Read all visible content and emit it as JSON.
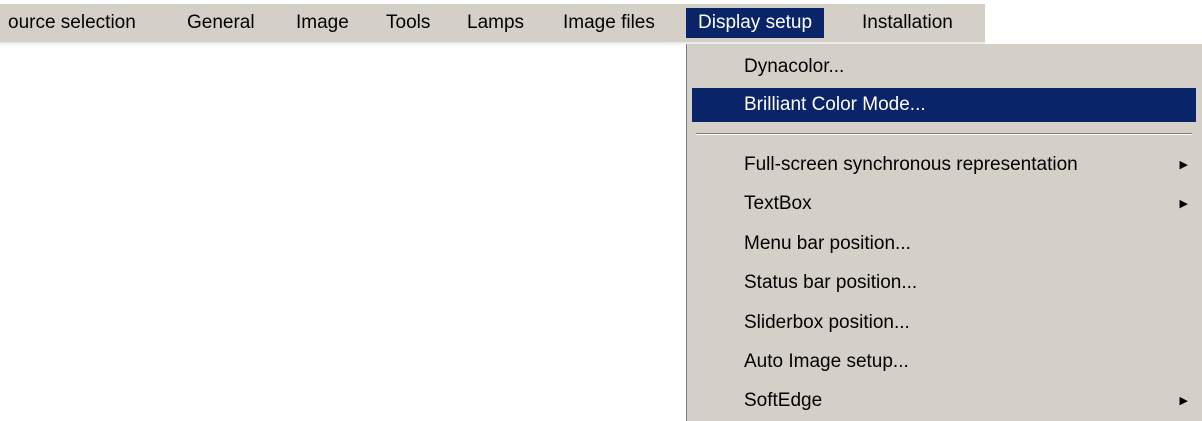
{
  "menubar": {
    "items": [
      {
        "label": "ource selection"
      },
      {
        "label": "General"
      },
      {
        "label": "Image"
      },
      {
        "label": "Tools"
      },
      {
        "label": "Lamps"
      },
      {
        "label": "Image files"
      },
      {
        "label": "Display setup",
        "active": true
      },
      {
        "label": "Installation"
      }
    ]
  },
  "dropdown": {
    "items": [
      {
        "label": "Dynacolor..."
      },
      {
        "label": "Brilliant Color Mode...",
        "highlighted": true
      },
      {
        "label": "Full-screen synchronous representation",
        "submenu_icon": "chevron-right-icon"
      },
      {
        "label": "TextBox",
        "submenu_icon": "chevron-right-icon"
      },
      {
        "label": "Menu bar position..."
      },
      {
        "label": "Status bar position..."
      },
      {
        "label": "Sliderbox position..."
      },
      {
        "label": "Auto Image setup..."
      },
      {
        "label": "SoftEdge",
        "submenu_icon": "chevron-right-icon"
      }
    ],
    "arrow_glyph": "▶"
  },
  "colors": {
    "menu_background": "#d4d0c8",
    "highlight_background": "#0a246a",
    "highlight_text": "#ffffff"
  }
}
